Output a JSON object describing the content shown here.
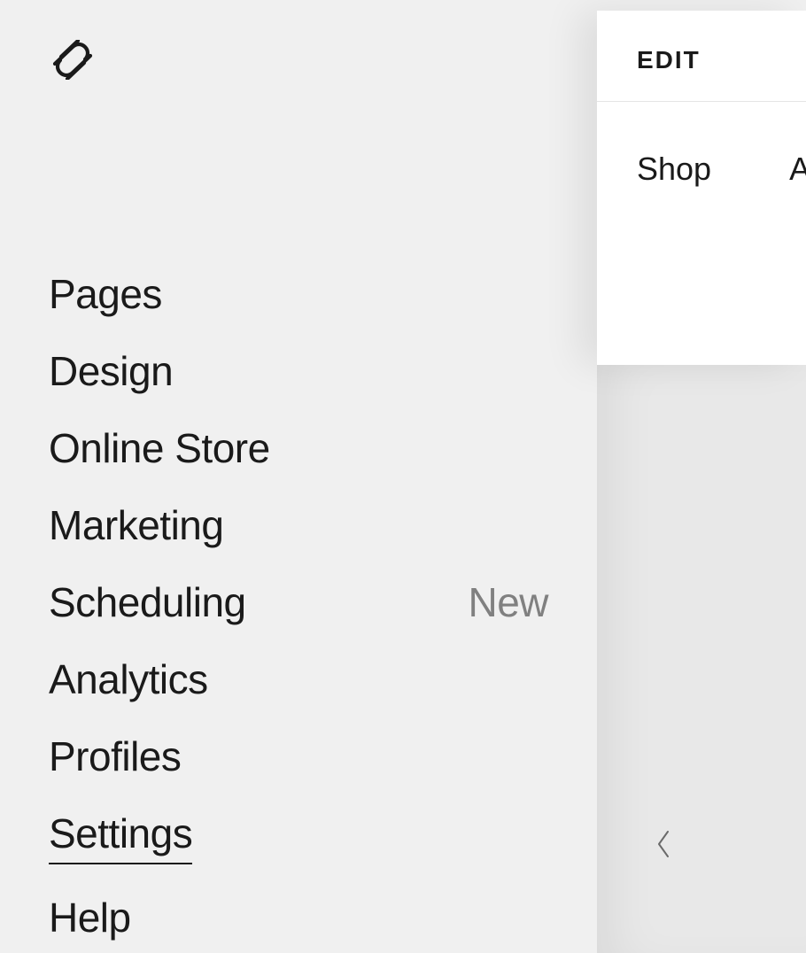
{
  "sidebar": {
    "nav": [
      {
        "label": "Pages",
        "badge": "",
        "active": false
      },
      {
        "label": "Design",
        "badge": "",
        "active": false
      },
      {
        "label": "Online Store",
        "badge": "",
        "active": false
      },
      {
        "label": "Marketing",
        "badge": "",
        "active": false
      },
      {
        "label": "Scheduling",
        "badge": "New",
        "active": false
      },
      {
        "label": "Analytics",
        "badge": "",
        "active": false
      },
      {
        "label": "Profiles",
        "badge": "",
        "active": false
      },
      {
        "label": "Settings",
        "badge": "",
        "active": true
      },
      {
        "label": "Help",
        "badge": "",
        "active": false
      }
    ]
  },
  "preview": {
    "edit_label": "EDIT",
    "nav": [
      {
        "label": "Shop"
      },
      {
        "label": "Ab"
      }
    ]
  }
}
